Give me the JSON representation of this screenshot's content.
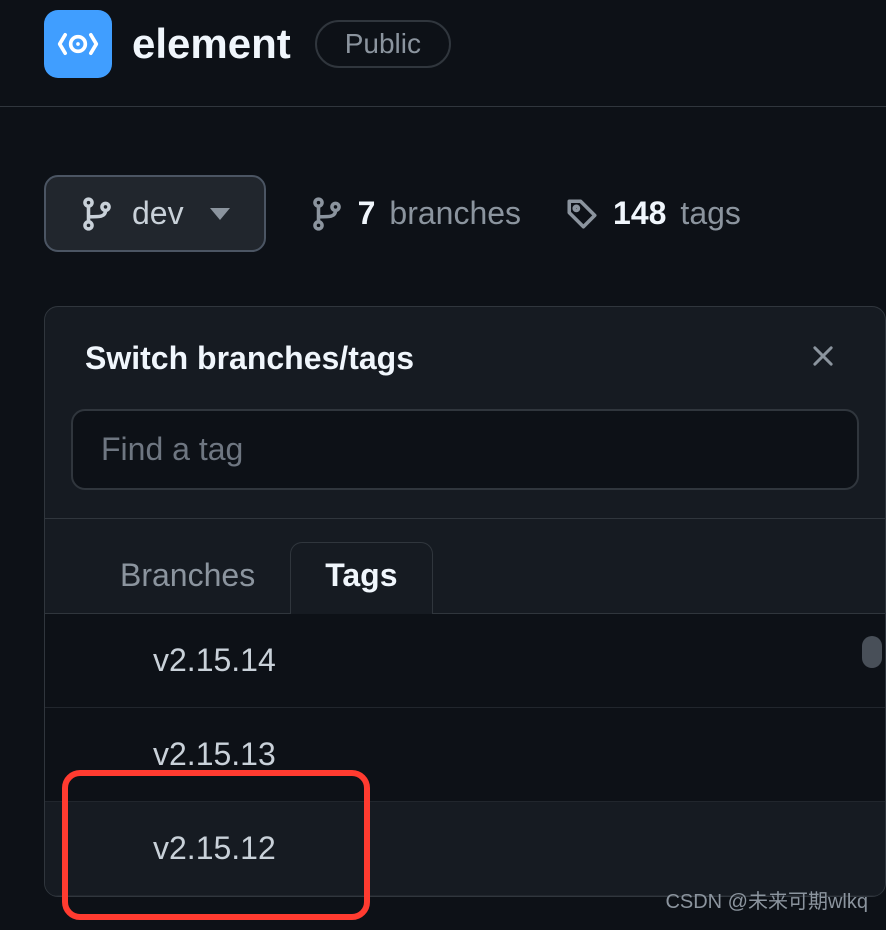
{
  "header": {
    "repo_name": "element",
    "visibility": "Public"
  },
  "toolbar": {
    "current_branch": "dev",
    "branches_count": "7",
    "branches_label": "branches",
    "tags_count": "148",
    "tags_label": "tags"
  },
  "popover": {
    "title": "Switch branches/tags",
    "search_placeholder": "Find a tag",
    "tabs": {
      "branches": "Branches",
      "tags": "Tags"
    },
    "tag_items": [
      "v2.15.14",
      "v2.15.13",
      "v2.15.12"
    ]
  },
  "watermark": "CSDN @未来可期wlkq"
}
